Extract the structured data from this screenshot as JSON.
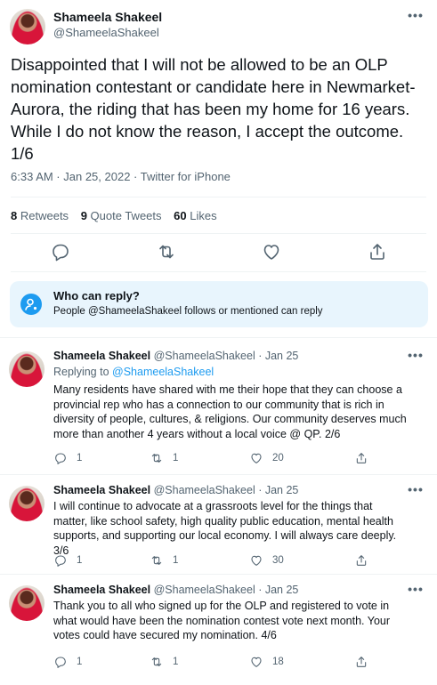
{
  "main_tweet": {
    "author_name": "Shameela Shakeel",
    "author_handle": "@ShameelaShakeel",
    "more_glyph": "•••",
    "text": "Disappointed that I will not be allowed to be an OLP nomination contestant or candidate here in Newmarket-Aurora, the riding that has been my home for 16 years. While I do not know the reason, I accept the outcome. 1/6",
    "meta": "6:33 AM · Jan 25, 2022 · Twitter for iPhone",
    "stats": {
      "retweets_count": "8",
      "retweets_label": "Retweets",
      "quotes_count": "9",
      "quotes_label": "Quote Tweets",
      "likes_count": "60",
      "likes_label": "Likes"
    },
    "actions": [
      "reply-icon",
      "retweet-icon",
      "like-icon",
      "share-icon"
    ]
  },
  "who_can_reply": {
    "title": "Who can reply?",
    "subtitle": "People @ShameelaShakeel follows or mentioned can reply",
    "icon": "person-mention-icon",
    "accent": "#1d9bf0"
  },
  "replies": [
    {
      "name": "Shameela Shakeel",
      "handle_date": "@ShameelaShakeel · Jan 25",
      "replying_prefix": "Replying to",
      "replying_to": "@ShameelaShakeel",
      "text": "Many residents have shared with me their hope that they can choose a provincial rep who has a connection to our community that is rich in diversity of people, cultures, & religions. Our community deserves much more than another 4 years without a local voice @ QP. 2/6",
      "replies": "1",
      "retweets": "1",
      "likes": "20"
    },
    {
      "name": "Shameela Shakeel",
      "handle_date": "@ShameelaShakeel · Jan 25",
      "text": "I will continue to advocate at a grassroots level for the things that matter, like school safety, high quality public education, mental health supports, and supporting our local economy. I will always care deeply. 3/6",
      "replies": "1",
      "retweets": "1",
      "likes": "30"
    },
    {
      "name": "Shameela Shakeel",
      "handle_date": "@ShameelaShakeel · Jan 25",
      "text": "Thank you to all who signed up for the OLP and registered to vote in what would have been the nomination contest vote next month. Your votes could have secured my nomination. 4/6",
      "replies": "1",
      "retweets": "1",
      "likes": "18"
    }
  ],
  "colors": {
    "text": "#0f1419",
    "secondary": "#536471",
    "link": "#1d9bf0",
    "divider": "#eff3f4",
    "reply_box_bg": "#e8f5fd"
  }
}
